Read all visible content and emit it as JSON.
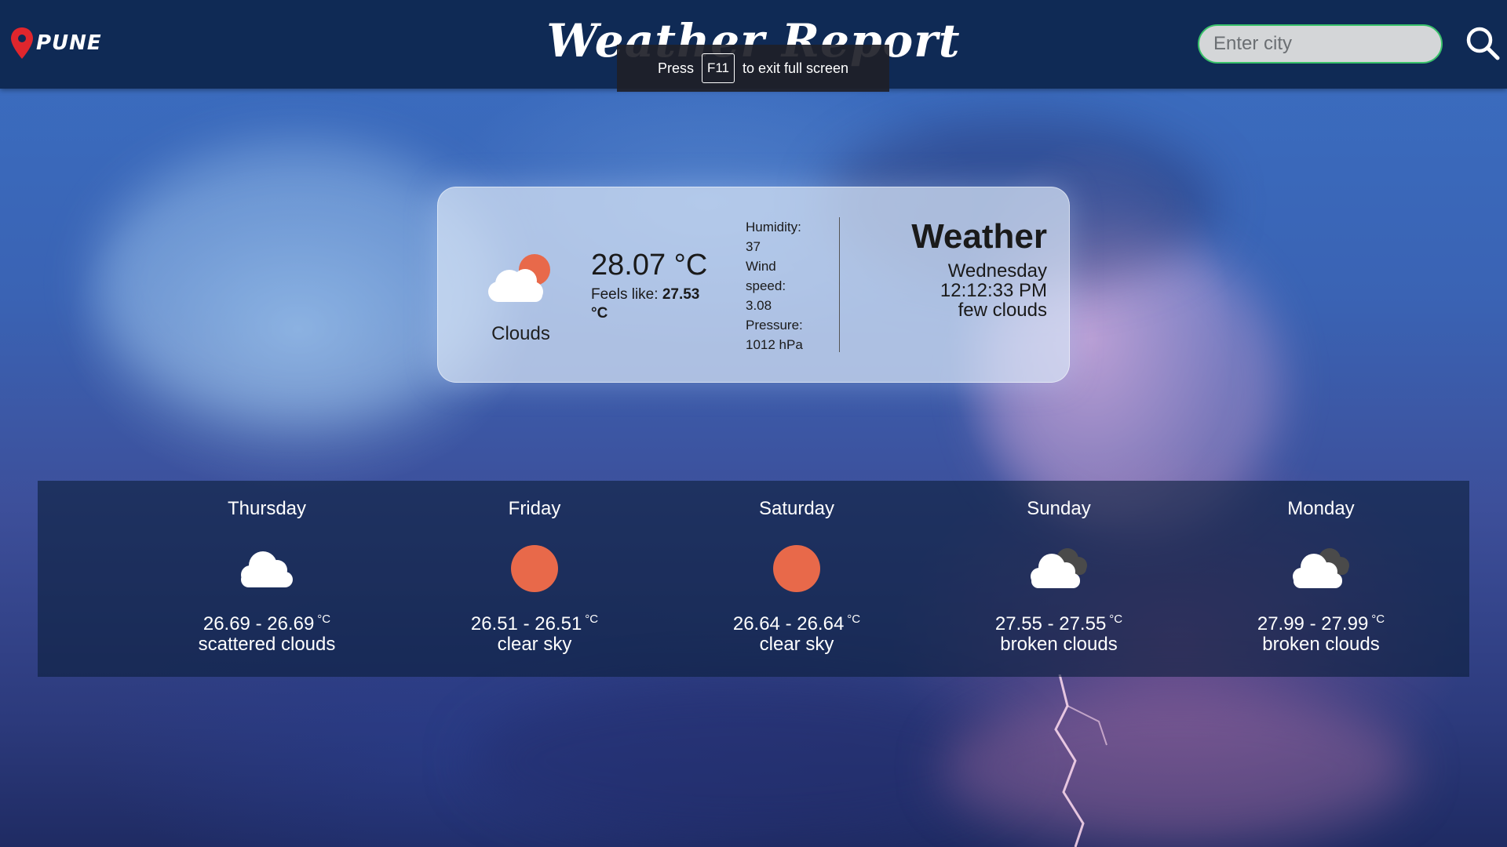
{
  "navbar": {
    "location": "PUNE",
    "title": "Weather Report",
    "fullscreen_notice": {
      "prefix": "Press",
      "key": "F11",
      "suffix": "to exit full screen"
    },
    "search": {
      "placeholder": "Enter city",
      "value": ""
    }
  },
  "current": {
    "condition": "Clouds",
    "temperature": "28.07 °C",
    "feels_like_label": "Feels like:",
    "feels_like_value": "27.53",
    "feels_like_unit": "°C",
    "humidity_label": "Humidity:",
    "humidity_value": "37",
    "wind_label_1": "Wind",
    "wind_label_2": "speed:",
    "wind_value": "3.08",
    "pressure_label": "Pressure:",
    "pressure_value": "1012 hPa",
    "heading": "Weather",
    "day": "Wednesday",
    "time": "12:12:33 PM",
    "description": "few clouds",
    "icon": "cloud-sun-icon"
  },
  "forecast": [
    {
      "day": "Thursday",
      "range": "26.69 - 26.69",
      "unit": "°C",
      "description": "scattered clouds",
      "icon": "cloud-icon"
    },
    {
      "day": "Friday",
      "range": "26.51 - 26.51",
      "unit": "°C",
      "description": "clear sky",
      "icon": "sun-icon"
    },
    {
      "day": "Saturday",
      "range": "26.64 - 26.64",
      "unit": "°C",
      "description": "clear sky",
      "icon": "sun-icon"
    },
    {
      "day": "Sunday",
      "range": "27.55 - 27.55",
      "unit": "°C",
      "description": "broken clouds",
      "icon": "broken-clouds-icon"
    },
    {
      "day": "Monday",
      "range": "27.99 - 27.99",
      "unit": "°C",
      "description": "broken clouds",
      "icon": "broken-clouds-icon"
    }
  ],
  "colors": {
    "navbar": "#0f2a55",
    "search_border": "#39c16a",
    "sun": "#e8694a",
    "pin": "#e0262d"
  }
}
